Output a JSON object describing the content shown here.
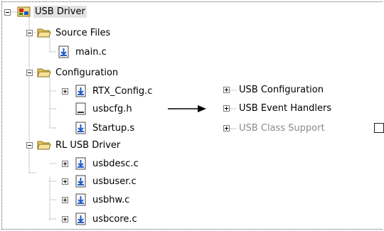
{
  "tree": {
    "root": {
      "label": "USB Driver"
    },
    "groups": [
      {
        "label": "Source Files",
        "files": [
          {
            "label": "main.c"
          }
        ]
      },
      {
        "label": "Configuration",
        "files": [
          {
            "label": "RTX_Config.c"
          },
          {
            "label": "usbcfg.h"
          },
          {
            "label": "Startup.s"
          }
        ]
      },
      {
        "label": "RL USB Driver",
        "files": [
          {
            "label": "usbdesc.c"
          },
          {
            "label": "usbuser.c"
          },
          {
            "label": "usbhw.c"
          },
          {
            "label": "usbcore.c"
          }
        ]
      }
    ]
  },
  "config_panel": {
    "items": [
      {
        "label": "USB Configuration",
        "state": "collapsed"
      },
      {
        "label": "USB Event Handlers",
        "state": "collapsed"
      },
      {
        "label": "USB Class Support",
        "state": "collapsed",
        "disabled": true
      }
    ]
  }
}
